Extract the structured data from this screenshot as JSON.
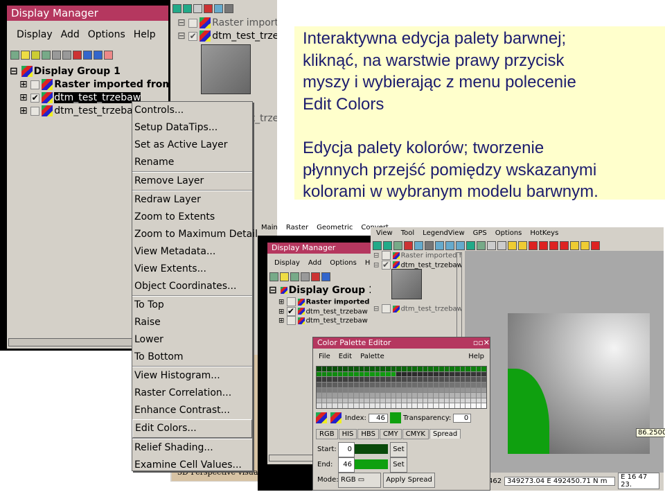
{
  "display_manager": {
    "title": "Display Manager",
    "menu": [
      "Display",
      "Add",
      "Options",
      "Help"
    ],
    "tree": {
      "group": "Display Group 1",
      "layers": [
        {
          "label": "Raster imported from",
          "checked": false
        },
        {
          "label": "dtm_test_trzebaw",
          "checked": true,
          "selected": true
        },
        {
          "label": "dtm_test_trzebaw",
          "checked": false
        }
      ]
    }
  },
  "legend_panel": {
    "layers": [
      "Raster imported from",
      "dtm_test_trzebaw",
      "dtm_test_trzebaw"
    ]
  },
  "context_menu": {
    "groups": [
      [
        "Controls...",
        "Setup DataTips...",
        "Set as Active Layer",
        "Rename"
      ],
      [
        "Remove Layer"
      ],
      [
        "Redraw Layer",
        "Zoom to Extents",
        "Zoom to Maximum Detail",
        "View Metadata...",
        "View Extents...",
        "Object Coordinates..."
      ],
      [
        "To Top",
        "Raise",
        "Lower",
        "To Bottom"
      ],
      [
        "View Histogram...",
        "Raster Correlation...",
        "Enhance Contrast...",
        "Edit Colors..."
      ],
      [
        "Relief Shading...",
        "Examine Cell Values..."
      ]
    ],
    "highlighted": "Edit Colors..."
  },
  "background_text": "3D Perspective visuali",
  "note": {
    "para1": [
      "Interaktywna edycja palety barwnej;",
      "kliknąć, na warstwie prawy przycisk",
      "myszy i wybierając  z menu polecenie",
      "Edit Colors"
    ],
    "para2": [
      "Edycja palety kolorów; tworzenie",
      "płynnych przejść pomiędzy wskazanymi",
      "kolorami w wybranym modelu barwnym."
    ]
  },
  "main_menu": [
    "Main",
    "Raster",
    "Geometric",
    "Convert"
  ],
  "view_window": {
    "menu": [
      "View",
      "Tool",
      "LegendView",
      "GPS",
      "Options",
      "HotKeys"
    ],
    "datatip": "86.2500",
    "status": {
      "left": "462",
      "coords": "349273.04 E  492450.71 N m",
      "latlon": "E 16 47 23."
    }
  },
  "palette_editor": {
    "title": "Color Palette Editor",
    "menu": [
      "File",
      "Edit",
      "Palette"
    ],
    "help": "Help",
    "index_label": "Index:",
    "index": "46",
    "transparency_label": "Transparency:",
    "transparency": "0",
    "tabs": [
      "RGB",
      "HIS",
      "HBS",
      "CMY",
      "CMYK",
      "Spread"
    ],
    "active_tab": "Spread",
    "start_label": "Start:",
    "start": "0",
    "end_label": "End:",
    "end": "46",
    "set": "Set",
    "mode_label": "Mode:",
    "mode": "RGB",
    "apply": "Apply Spread"
  },
  "colors": {
    "title_bar": "#b5375f",
    "start_color": "#0a4a0a",
    "end_color": "#0fa00f",
    "note_bg": "#ffffcc"
  }
}
